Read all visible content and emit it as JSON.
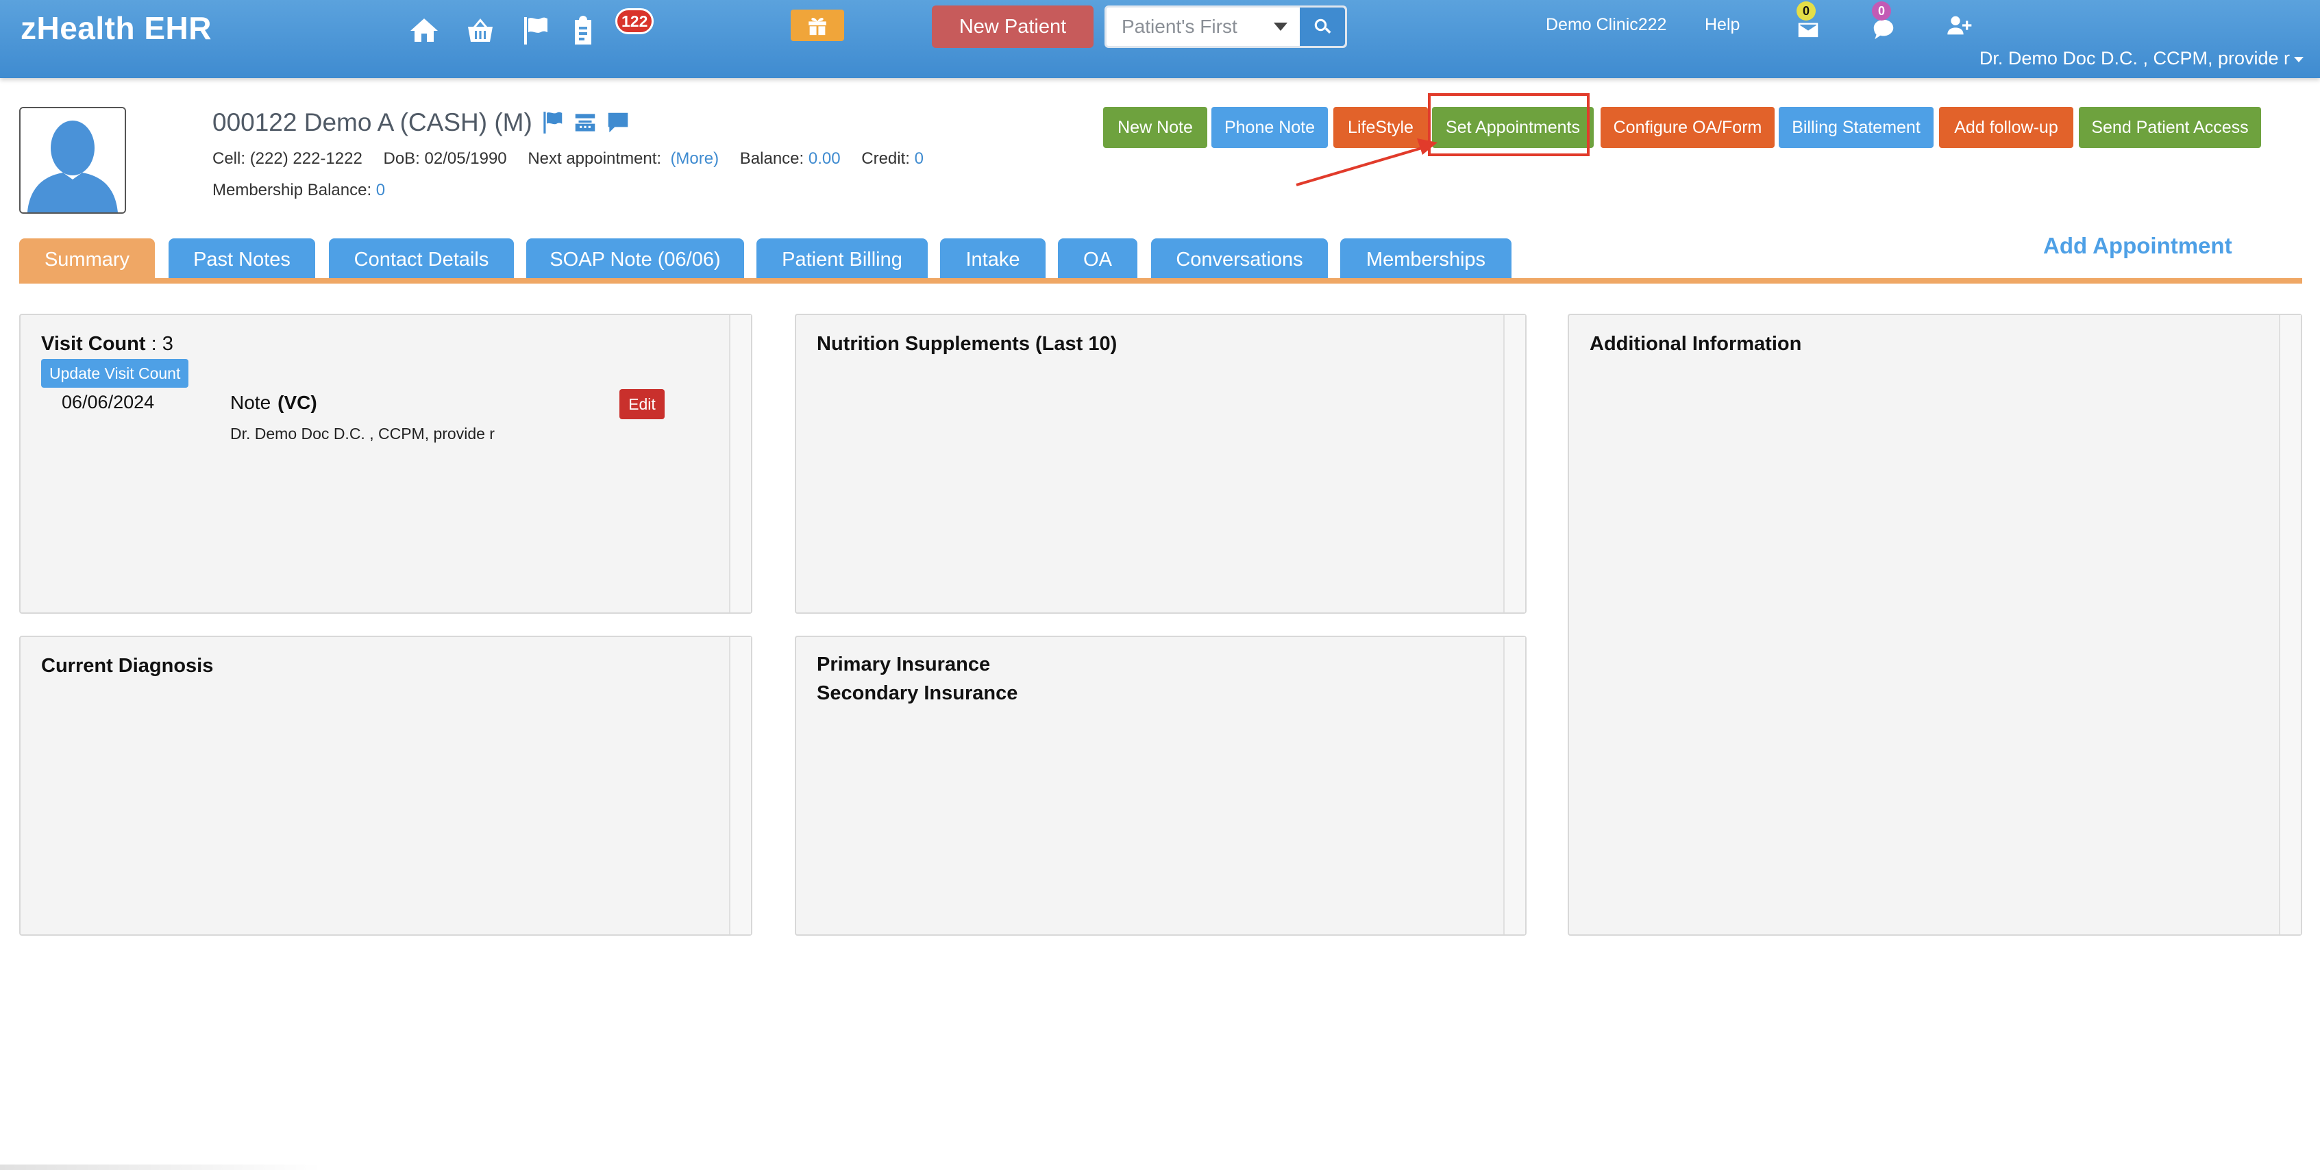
{
  "app": {
    "brand": "zHealth EHR"
  },
  "topbar": {
    "icons": [
      "home-icon",
      "basket-icon",
      "flag-icon",
      "clipboard-icon"
    ],
    "task_badge": "122",
    "new_patient_label": "New Patient",
    "search_select": "Patient's First",
    "clinic": "Demo Clinic222",
    "help": "Help",
    "mail_badge": "0",
    "chat_badge": "0",
    "user": "Dr. Demo Doc D.C. , CCPM, provide r"
  },
  "patient": {
    "name": "000122 Demo A  (CASH) (M)",
    "cell_label": "Cell:",
    "cell": "(222) 222-1222",
    "dob_label": "DoB:",
    "dob": "02/05/1990",
    "next_appt_label": "Next appointment:",
    "more": "(More)",
    "balance_label": "Balance:",
    "balance": "0.00",
    "credit_label": "Credit:",
    "credit": "0",
    "membership_label": "Membership Balance:",
    "membership_balance": "0"
  },
  "actions": [
    {
      "label": "New Note",
      "color": "#6ea23e"
    },
    {
      "label": "Phone Note",
      "color": "#4ea0e6"
    },
    {
      "label": "LifeStyle",
      "color": "#e2622a"
    },
    {
      "label": "Set Appointments",
      "color": "#6ea23e"
    },
    {
      "label": "Configure OA/Form",
      "color": "#e2622a"
    },
    {
      "label": "Billing Statement",
      "color": "#4ea0e6"
    },
    {
      "label": "Add follow-up",
      "color": "#e2622a"
    },
    {
      "label": "Send Patient Access",
      "color": "#6ea23e"
    }
  ],
  "tabs": [
    {
      "label": "Summary",
      "active": true
    },
    {
      "label": "Past Notes"
    },
    {
      "label": "Contact Details"
    },
    {
      "label": "SOAP Note (06/06)"
    },
    {
      "label": "Patient Billing"
    },
    {
      "label": "Intake"
    },
    {
      "label": "OA"
    },
    {
      "label": "Conversations"
    },
    {
      "label": "Memberships"
    }
  ],
  "add_appointment": "Add Appointment",
  "panels": {
    "visits": {
      "count_label": "Visit Count",
      "count": ": 3",
      "update_label": "Update Visit Count",
      "note": {
        "date": "06/06/2024",
        "title": "Note",
        "type": "(VC)",
        "author": "Dr. Demo Doc D.C. , CCPM, provide r",
        "edit_label": "Edit"
      }
    },
    "nutrition_title": "Nutrition Supplements (Last 10)",
    "additional_title": "Additional Information",
    "diagnosis_title": "Current Diagnosis",
    "primary_insurance": "Primary Insurance",
    "secondary_insurance": "Secondary Insurance"
  },
  "colors": {
    "header": "#4a94d6",
    "accent_tab": "#efa765",
    "highlight": "#e13b2b"
  }
}
